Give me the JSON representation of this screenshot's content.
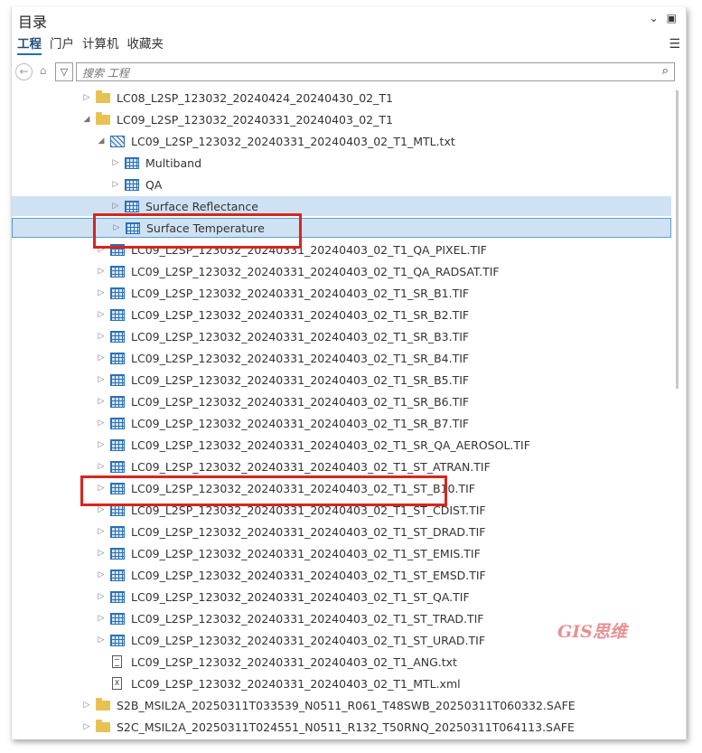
{
  "title": "目录",
  "tabs": [
    {
      "label": "工程",
      "active": true
    },
    {
      "label": "门户",
      "active": false
    },
    {
      "label": "计算机",
      "active": false
    },
    {
      "label": "收藏夹",
      "active": false
    }
  ],
  "search": {
    "placeholder": "搜索 工程"
  },
  "watermark": "GIS思维",
  "colors": {
    "highlight": "#cfe2f3",
    "annotation_box": "#d9251d",
    "folder": "#e7c152",
    "raster": "#2f6fb3"
  },
  "tree": [
    {
      "label": "LC08_L2SP_123032_20240424_20240430_02_T1",
      "type": "folder",
      "expander": "collapsed"
    },
    {
      "label": "LC09_L2SP_123032_20240331_20240403_02_T1",
      "type": "folder",
      "expander": "expanded"
    },
    {
      "label": "LC09_L2SP_123032_20240331_20240403_02_T1_MTL.txt",
      "type": "mtl",
      "expander": "expanded"
    },
    {
      "label": "Multiband",
      "type": "raster",
      "expander": "collapsed"
    },
    {
      "label": "QA",
      "type": "raster",
      "expander": "collapsed"
    },
    {
      "label": "Surface Reflectance",
      "type": "raster",
      "expander": "collapsed"
    },
    {
      "label": "Surface Temperature",
      "type": "raster",
      "expander": "collapsed"
    },
    {
      "label": "LC09_L2SP_123032_20240331_20240403_02_T1_QA_PIXEL.TIF",
      "type": "raster",
      "expander": "collapsed"
    },
    {
      "label": "LC09_L2SP_123032_20240331_20240403_02_T1_QA_RADSAT.TIF",
      "type": "raster",
      "expander": "collapsed"
    },
    {
      "label": "LC09_L2SP_123032_20240331_20240403_02_T1_SR_B1.TIF",
      "type": "raster",
      "expander": "collapsed"
    },
    {
      "label": "LC09_L2SP_123032_20240331_20240403_02_T1_SR_B2.TIF",
      "type": "raster",
      "expander": "collapsed"
    },
    {
      "label": "LC09_L2SP_123032_20240331_20240403_02_T1_SR_B3.TIF",
      "type": "raster",
      "expander": "collapsed"
    },
    {
      "label": "LC09_L2SP_123032_20240331_20240403_02_T1_SR_B4.TIF",
      "type": "raster",
      "expander": "collapsed"
    },
    {
      "label": "LC09_L2SP_123032_20240331_20240403_02_T1_SR_B5.TIF",
      "type": "raster",
      "expander": "collapsed"
    },
    {
      "label": "LC09_L2SP_123032_20240331_20240403_02_T1_SR_B6.TIF",
      "type": "raster",
      "expander": "collapsed"
    },
    {
      "label": "LC09_L2SP_123032_20240331_20240403_02_T1_SR_B7.TIF",
      "type": "raster",
      "expander": "collapsed"
    },
    {
      "label": "LC09_L2SP_123032_20240331_20240403_02_T1_SR_QA_AEROSOL.TIF",
      "type": "raster",
      "expander": "collapsed"
    },
    {
      "label": "LC09_L2SP_123032_20240331_20240403_02_T1_ST_ATRAN.TIF",
      "type": "raster",
      "expander": "collapsed"
    },
    {
      "label": "LC09_L2SP_123032_20240331_20240403_02_T1_ST_B10.TIF",
      "type": "raster",
      "expander": "collapsed"
    },
    {
      "label": "LC09_L2SP_123032_20240331_20240403_02_T1_ST_CDIST.TIF",
      "type": "raster",
      "expander": "collapsed"
    },
    {
      "label": "LC09_L2SP_123032_20240331_20240403_02_T1_ST_DRAD.TIF",
      "type": "raster",
      "expander": "collapsed"
    },
    {
      "label": "LC09_L2SP_123032_20240331_20240403_02_T1_ST_EMIS.TIF",
      "type": "raster",
      "expander": "collapsed"
    },
    {
      "label": "LC09_L2SP_123032_20240331_20240403_02_T1_ST_EMSD.TIF",
      "type": "raster",
      "expander": "collapsed"
    },
    {
      "label": "LC09_L2SP_123032_20240331_20240403_02_T1_ST_QA.TIF",
      "type": "raster",
      "expander": "collapsed"
    },
    {
      "label": "LC09_L2SP_123032_20240331_20240403_02_T1_ST_TRAD.TIF",
      "type": "raster",
      "expander": "collapsed"
    },
    {
      "label": "LC09_L2SP_123032_20240331_20240403_02_T1_ST_URAD.TIF",
      "type": "raster",
      "expander": "collapsed"
    },
    {
      "label": "LC09_L2SP_123032_20240331_20240403_02_T1_ANG.txt",
      "type": "text",
      "expander": "none"
    },
    {
      "label": "LC09_L2SP_123032_20240331_20240403_02_T1_MTL.xml",
      "type": "xml",
      "expander": "none"
    },
    {
      "label": "S2B_MSIL2A_20250311T033539_N0511_R061_T48SWB_20250311T060332.SAFE",
      "type": "folder",
      "expander": "collapsed"
    },
    {
      "label": "S2C_MSIL2A_20250311T024551_N0511_R132_T50RNQ_20250311T064113.SAFE",
      "type": "folder",
      "expander": "collapsed"
    }
  ]
}
